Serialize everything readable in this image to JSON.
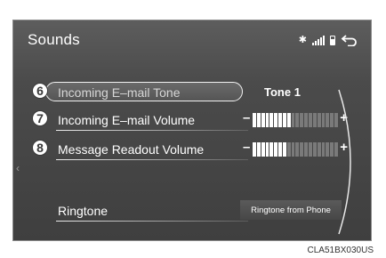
{
  "screen": {
    "title": "Sounds",
    "status_icons": [
      "bluetooth-icon",
      "signal-icon",
      "battery-icon"
    ],
    "back_icon": "back-arrow-icon"
  },
  "rows": [
    {
      "callout": "6",
      "label": "Incoming E–mail Tone",
      "value": "Tone 1",
      "selected": true
    },
    {
      "callout": "7",
      "label": "Incoming E–mail Volume",
      "volume_level": 0.45,
      "minus": "–",
      "plus": "+"
    },
    {
      "callout": "8",
      "label": "Message Readout Volume",
      "volume_level": 0.4,
      "minus": "–",
      "plus": "+"
    },
    {
      "label": "Ringtone",
      "button_label": "Ringtone from Phone"
    }
  ],
  "caption": "CLA51BX030US",
  "colors": {
    "screen_bg": "#4a4a4a",
    "text": "#ffffff",
    "volume_on": "#ffffff",
    "volume_off": "#7a7a7a"
  }
}
